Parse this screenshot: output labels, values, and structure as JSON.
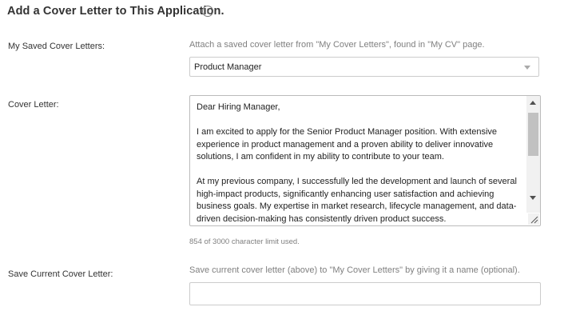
{
  "header": {
    "title": "Add a Cover Letter to This Application.",
    "info_icon": "info-icon"
  },
  "saved_letters": {
    "label": "My Saved Cover Letters:",
    "hint": "Attach a saved cover letter from \"My Cover Letters\", found in \"My CV\" page.",
    "selected": "Product Manager",
    "icon": "chevron-down-icon"
  },
  "cover_letter": {
    "label": "Cover Letter:",
    "paragraphs": [
      "Dear Hiring Manager,",
      "I am excited to apply for the Senior Product Manager position. With extensive experience in product management and a proven ability to deliver innovative solutions, I am confident in my ability to contribute to your team.",
      "At my previous company, I successfully led the development and launch of several high-impact products, significantly enhancing user satisfaction and achieving business goals. My expertise in market research, lifecycle management, and data-driven decision-making has consistently driven product success."
    ],
    "char_count": "854 of 3000 character limit used."
  },
  "save_current": {
    "label": "Save Current Cover Letter:",
    "hint": "Save current cover letter (above) to \"My Cover Letters\" by giving it a name (optional).",
    "value": ""
  }
}
